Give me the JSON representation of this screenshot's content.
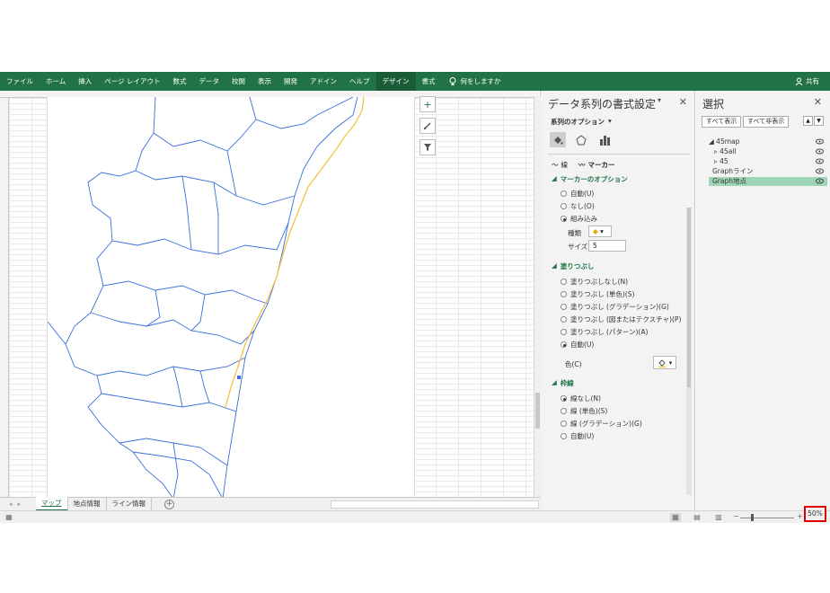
{
  "ribbon": {
    "tabs": [
      "ファイル",
      "ホーム",
      "挿入",
      "ページ レイアウト",
      "数式",
      "データ",
      "校閲",
      "表示",
      "開発",
      "アドイン",
      "ヘルプ",
      "デザイン",
      "書式"
    ],
    "active_tab": "デザイン",
    "tell_me": "何をしますか",
    "share": "共有"
  },
  "sheet": {
    "tabs": [
      "マップ",
      "地点情報",
      "ライン情報"
    ],
    "active": "マップ"
  },
  "format_pane": {
    "title": "データ系列の書式設定",
    "series_options": "系列のオプション",
    "subtab_line": "線",
    "subtab_marker": "マーカー",
    "marker_options_header": "マーカーのオプション",
    "marker_opts": [
      "自動(U)",
      "なし(O)",
      "組み込み"
    ],
    "type_label": "種類",
    "size_label": "サイズ",
    "size_value": "5",
    "fill_header": "塗りつぶし",
    "fill_opts": [
      "塗りつぶしなし(N)",
      "塗りつぶし (単色)(S)",
      "塗りつぶし (グラデーション)(G)",
      "塗りつぶし (図またはテクスチャ)(P)",
      "塗りつぶし (パターン)(A)",
      "自動(U)"
    ],
    "color_label": "色(C)",
    "border_header": "枠線",
    "border_opts": [
      "線なし(N)",
      "線 (単色)(S)",
      "線 (グラデーション)(G)",
      "自動(U)"
    ]
  },
  "selection_pane": {
    "title": "選択",
    "show_all": "すべて表示",
    "hide_all": "すべて非表示",
    "items": [
      "45map",
      "45all",
      "45",
      "Graphライン",
      "Graph地点"
    ],
    "selected": "Graph地点"
  },
  "status": {
    "zoom": "50%"
  },
  "colors": {
    "excel_green": "#217346",
    "border_line": "#3a6fd8",
    "route_line": "#f5c342",
    "selection_highlight": "#9fd5b7",
    "zoom_highlight": "#e00000"
  }
}
